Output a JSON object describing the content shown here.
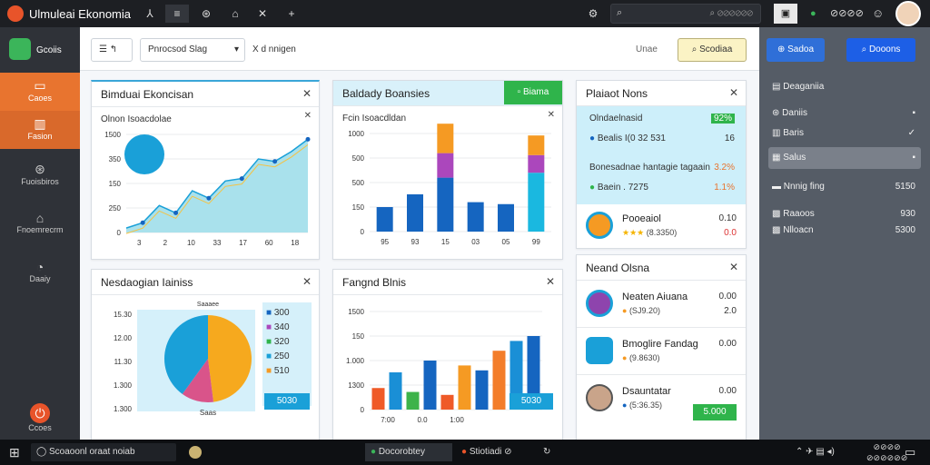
{
  "app": {
    "title": "Ulmuleai Ekonomia"
  },
  "titlebar": {
    "tabs": [
      "⅄",
      "≡",
      "⊛",
      "⌂",
      "✕",
      "+"
    ],
    "search_placeholder": "⌕ ⊘⊘⊘⊘⊘⊘",
    "user_label": "⊘⊘⊘⊘"
  },
  "sidebar": {
    "brand": "Gcoiis",
    "items": [
      {
        "label": "Caoes"
      },
      {
        "label": "Fasion"
      },
      {
        "label": "Fuoisbiros"
      },
      {
        "label": "Fnoemrecrm"
      },
      {
        "label": "Daaiy"
      },
      {
        "label": "Ccoes"
      }
    ]
  },
  "toolbar": {
    "menu_btn": "☰  ↰",
    "dropdown": "Pnrocsod  Slag",
    "extra": "X d nnigen",
    "right_label": "Unae",
    "action_btn": "Scodiaa"
  },
  "cards": {
    "c1": {
      "title": "Bimduai Ekoncisan",
      "subtitle": "Olnon Isoacdolae"
    },
    "c2": {
      "title": "Baldady Boansies",
      "subtitle": "Fcin Isoacdldan",
      "badge": "▫ Biama"
    },
    "c3": {
      "title": "Plaiaot Nons",
      "row1_title": "Olndaelnasid",
      "row1_badge": "92%",
      "row1_sub": "Bealis I(0 32 531",
      "row1_val": "16",
      "row2_title": "Bonesadnae hantagie tagaain",
      "row2_badge": "3.2%",
      "row2_sub": "Baein . 7275",
      "row2_val": "1.1%",
      "row3_title": "Pooeaiol",
      "row3_sub": "(8.3350)",
      "row3_val": "0.10",
      "row3_val2": "0.0"
    },
    "c4": {
      "title": "Nesdaogian Iainiss",
      "pie_label_top": "Saaaee",
      "pie_label_bottom": "Saas",
      "legend": [
        "300",
        "340",
        "320",
        "250",
        "510"
      ],
      "button": "5030"
    },
    "c5": {
      "title": "Fangnd Blnis",
      "button": "5030"
    },
    "c6": {
      "title": "Neand Olsna",
      "items": [
        {
          "title": "Neaten Aiuana",
          "sub": "(SJ9.20)",
          "val": "2.0",
          "val2": "0.00"
        },
        {
          "title": "Bmoglire Fandag",
          "sub": "(9.8630)",
          "val": "0.00"
        },
        {
          "title": "Dsauntatar",
          "sub": "(5:36.35)",
          "val": "0.00",
          "button": "5.000"
        }
      ]
    }
  },
  "chart_data": [
    {
      "type": "area",
      "title": "Bimduai Ekoncisan",
      "yticks": [
        "1500",
        "350",
        "150",
        "250",
        "0"
      ],
      "xticks": [
        "3",
        "2",
        "10",
        "33",
        "17",
        "60",
        "18"
      ],
      "x": [
        1,
        2,
        3,
        4,
        5,
        6,
        7,
        8,
        9,
        10,
        11,
        12
      ],
      "values": [
        90,
        200,
        550,
        400,
        850,
        700,
        1050,
        1100,
        1500,
        1450,
        1650,
        1900
      ],
      "ylim": [
        0,
        2000
      ],
      "grid": true
    },
    {
      "type": "bar",
      "title": "Baldady Boansies",
      "yticks": [
        "1000",
        "500",
        "500",
        "150",
        "0"
      ],
      "xticks": [
        "95",
        "93",
        "15",
        "03",
        "05",
        "99"
      ],
      "series": [
        {
          "name": "a",
          "values": [
            25,
            38,
            55,
            30,
            28,
            60
          ],
          "color": "#1565c0"
        },
        {
          "name": "b",
          "values": [
            0,
            0,
            25,
            0,
            0,
            18
          ],
          "color": "#ab47bc"
        },
        {
          "name": "c",
          "values": [
            0,
            0,
            30,
            0,
            0,
            20
          ],
          "color": "#f59a23"
        }
      ],
      "ylim": [
        0,
        100
      ],
      "grid": true
    },
    {
      "type": "pie",
      "title": "Nesdaogian Iainiss",
      "yticks": [
        "15.30",
        "12.00",
        "11.30",
        "1.300",
        "1.300"
      ],
      "slices": [
        {
          "label": "A",
          "value": 48,
          "color": "#f6a91e"
        },
        {
          "label": "B",
          "value": 12,
          "color": "#d9548a"
        },
        {
          "label": "C",
          "value": 40,
          "color": "#1aa0d8"
        }
      ]
    },
    {
      "type": "bar",
      "title": "Fangnd Blnis",
      "yticks": [
        "1500",
        "150",
        "1.000",
        "1300",
        "0"
      ],
      "xticks": [
        "7:00",
        "0.0",
        "1:00"
      ],
      "values": [
        22,
        38,
        18,
        50,
        15,
        45,
        40,
        60,
        70,
        75
      ],
      "colors": [
        "#ef5a28",
        "#1a8fd6",
        "#3db34a",
        "#1565c0",
        "#ef5a28",
        "#f59a23",
        "#1565c0",
        "#f37d2a",
        "#1a8fd6",
        "#1565c0"
      ],
      "ylim": [
        0,
        100
      ],
      "grid": true
    }
  ],
  "rightpanel": {
    "btn1": "Sadoa",
    "btn2": "Dooons",
    "items": [
      {
        "label": "Deaganiia",
        "val": ""
      },
      {
        "label": "Daniis",
        "val": "▪"
      },
      {
        "label": "Baris",
        "val": "✓"
      },
      {
        "label": "Salus",
        "val": "▪"
      },
      {
        "label": "Nnnig fing",
        "val": "5150"
      },
      {
        "label": "Raaoos",
        "val": "930"
      },
      {
        "label": "Nlloacn",
        "val": "5300"
      }
    ]
  },
  "taskbar": {
    "search": "Scoaoonl oraat noiab",
    "app1": "Docorobtey",
    "app2": "Stiotiadi ⊘",
    "time": "⊘⊘⊘⊘",
    "date": "⊘⊘⊘⊘⊘⊘"
  }
}
